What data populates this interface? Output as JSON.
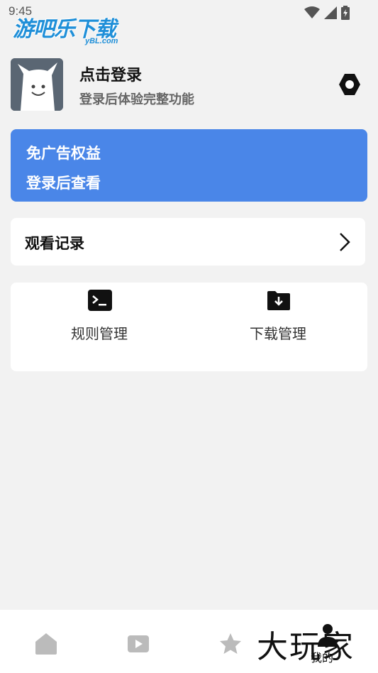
{
  "status_bar": {
    "time": "9:45"
  },
  "watermark": {
    "main": "游吧乐下载",
    "sub": "yBL.com"
  },
  "profile": {
    "name": "点击登录",
    "subtitle": "登录后体验完整功能"
  },
  "ad_card": {
    "title": "免广告权益",
    "subtitle": "登录后查看"
  },
  "history": {
    "label": "观看记录"
  },
  "tools": [
    {
      "label": "规则管理",
      "icon": "terminal-icon"
    },
    {
      "label": "下载管理",
      "icon": "folder-download-icon"
    }
  ],
  "bottom_nav": {
    "items": [
      {
        "icon": "home-icon"
      },
      {
        "icon": "play-icon"
      },
      {
        "icon": "star-icon"
      },
      {
        "icon": "person-icon",
        "label": "我的"
      }
    ]
  },
  "corner_watermark": "大玩家",
  "colors": {
    "accent": "#4a86e8",
    "background": "#f2f2f2"
  }
}
